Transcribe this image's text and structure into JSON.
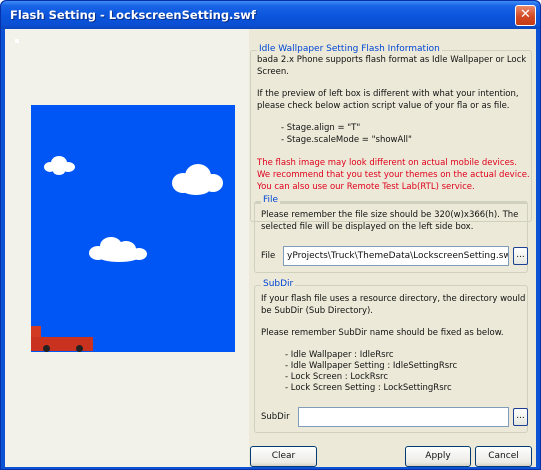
{
  "window": {
    "title": "Flash Setting - LockscreenSetting.swf",
    "close_glyph": "✕"
  },
  "info_group": {
    "legend": "Idle Wallpaper Setting Flash Information",
    "line1": "bada 2.x Phone supports flash format as Idle Wallpaper or Lock",
    "line2": "Screen.",
    "line3": "If the preview of left box is different with what your intention,",
    "line4": "please check below action script value of your fla or as file.",
    "align": "- Stage.align = \"T\"",
    "scale": "- Stage.scaleMode = \"showAll\"",
    "warn1": "The flash image may look different on actual mobile devices.",
    "warn2": "We recommend that you test your themes on the actual device.",
    "warn3": "You can also use our Remote Test Lab(RTL) service."
  },
  "file_group": {
    "legend": "File",
    "line1": "Please remember the file size should be 320(w)x366(h). The",
    "line2": "selected file will be displayed on the left side box.",
    "label": "File",
    "value": "yProjects\\Truck\\ThemeData\\LockscreenSetting.swf",
    "browse": "..."
  },
  "subdir_group": {
    "legend": "SubDir",
    "line1": "If your flash file uses a resource directory, the directory would",
    "line2": "be SubDir (Sub Directory).",
    "line3": "Please remember SubDir name should be fixed as below.",
    "item1": "- Idle Wallpaper : IdleRsrc",
    "item2": "- Idle Wallpaper Setting : IdleSettingRsrc",
    "item3": "- Lock Screen : LockRsrc",
    "item4": "- Lock Screen Setting : LockSettingRsrc",
    "label": "SubDir",
    "value": "",
    "browse": "..."
  },
  "buttons": {
    "clear": "Clear",
    "apply": "Apply",
    "cancel": "Cancel"
  },
  "colors": {
    "accent": "#0046d5",
    "warning": "#e0001c",
    "stage": "#0055f5"
  }
}
